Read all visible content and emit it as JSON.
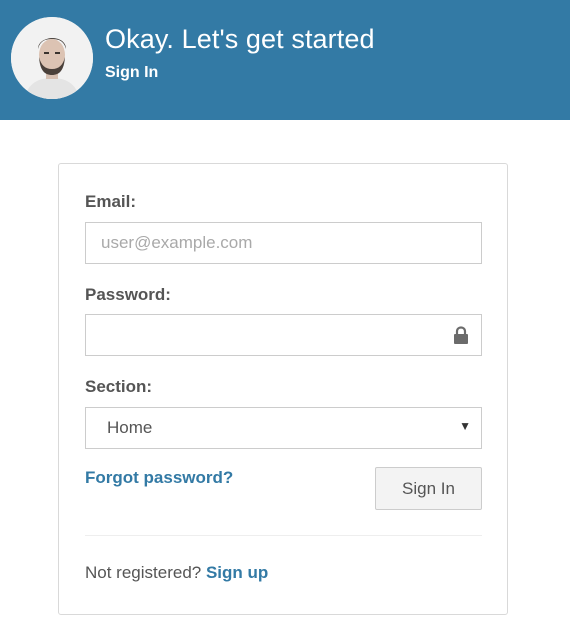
{
  "header": {
    "title": "Okay. Let's get started",
    "subtitle": "Sign In",
    "avatar_icon": "user-avatar-photo"
  },
  "form": {
    "email_label": "Email:",
    "email_placeholder": "user@example.com",
    "email_value": "",
    "password_label": "Password:",
    "password_value": "",
    "password_icon": "lock-icon",
    "section_label": "Section:",
    "section_selected": "Home",
    "forgot_label": "Forgot password?",
    "signin_button_label": "Sign In",
    "not_registered_text": "Not registered?",
    "signup_label": "Sign up"
  },
  "colors": {
    "header_bg": "#337aa5",
    "link": "#337aa5",
    "text": "#555555",
    "button_bg": "#f3f3f3"
  }
}
